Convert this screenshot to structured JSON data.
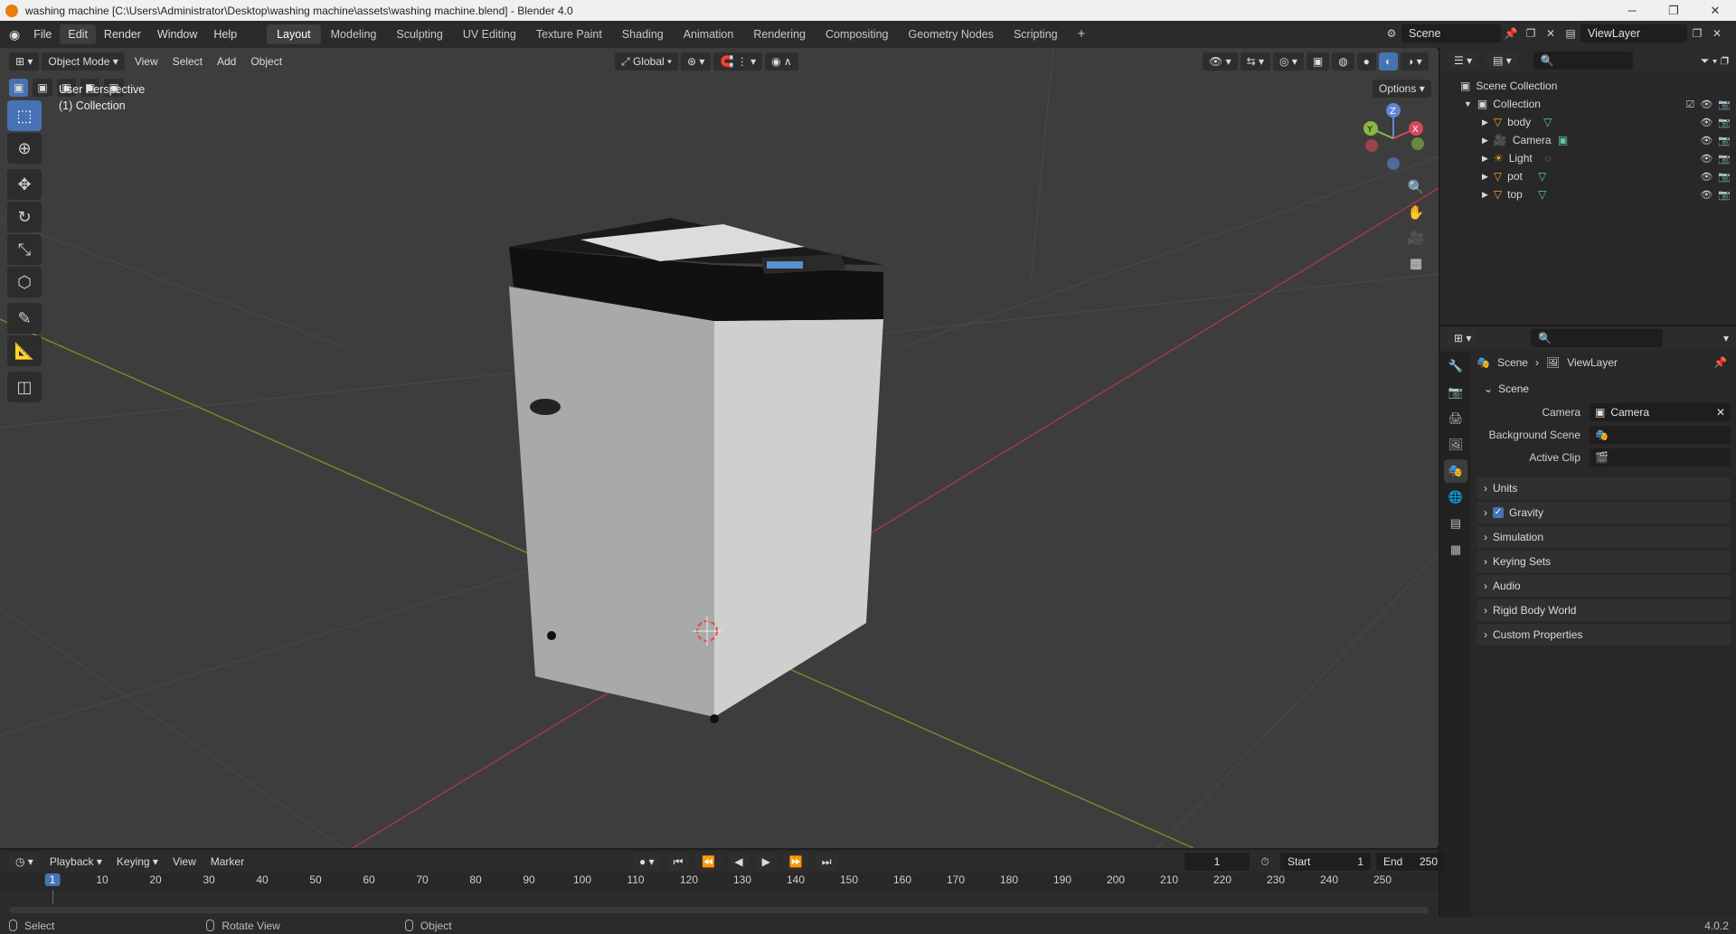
{
  "window": {
    "title": "washing machine [C:\\Users\\Administrator\\Desktop\\washing machine\\assets\\washing machine.blend] - Blender 4.0"
  },
  "menu": [
    "File",
    "Edit",
    "Render",
    "Window",
    "Help"
  ],
  "workspaces": [
    "Layout",
    "Modeling",
    "Sculpting",
    "UV Editing",
    "Texture Paint",
    "Shading",
    "Animation",
    "Rendering",
    "Compositing",
    "Geometry Nodes",
    "Scripting"
  ],
  "topbar": {
    "scene": "Scene",
    "view_layer": "ViewLayer"
  },
  "viewport": {
    "mode": "Object Mode",
    "menus": [
      "View",
      "Select",
      "Add",
      "Object"
    ],
    "transform_orientation": "Global",
    "options_label": "Options",
    "overlay_title": "User Perspective",
    "overlay_collection": "(1) Collection",
    "gizmo": {
      "x": "X",
      "y": "Y",
      "z": "Z"
    }
  },
  "outliner": {
    "root": "Scene Collection",
    "collection": "Collection",
    "items": [
      "body",
      "Camera",
      "Light",
      "pot",
      "top"
    ]
  },
  "properties": {
    "breadcrumb_scene": "Scene",
    "breadcrumb_layer": "ViewLayer",
    "panel": "Scene",
    "camera_label": "Camera",
    "camera_value": "Camera",
    "background_scene_label": "Background Scene",
    "active_clip_label": "Active Clip",
    "sections": [
      "Units",
      "Gravity",
      "Simulation",
      "Keying Sets",
      "Audio",
      "Rigid Body World",
      "Custom Properties"
    ]
  },
  "timeline": {
    "menus": [
      "Playback",
      "Keying",
      "View",
      "Marker"
    ],
    "current_frame": "1",
    "start_label": "Start",
    "start": "1",
    "end_label": "End",
    "end": "250",
    "ticks": [
      "1",
      "10",
      "20",
      "30",
      "40",
      "50",
      "60",
      "70",
      "80",
      "90",
      "100",
      "110",
      "120",
      "130",
      "140",
      "150",
      "160",
      "170",
      "180",
      "190",
      "200",
      "210",
      "220",
      "230",
      "240",
      "250"
    ]
  },
  "status": {
    "select": "Select",
    "rotate": "Rotate View",
    "object": "Object",
    "version": "4.0.2"
  }
}
